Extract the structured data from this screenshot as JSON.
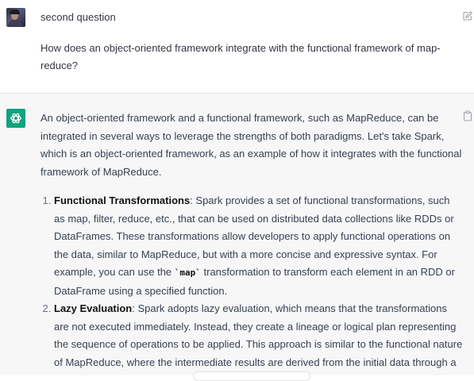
{
  "user_message": {
    "title": "second question",
    "text": "How does an object-oriented framework integrate with the functional framework of map-reduce?"
  },
  "assistant_message": {
    "intro": "An object-oriented framework and a functional framework, such as MapReduce, can be integrated in several ways to leverage the strengths of both paradigms. Let's take Spark, which is an object-oriented framework, as an example of how it integrates with the functional framework of MapReduce.",
    "items": [
      {
        "title": "Functional Transformations",
        "text_before_code": ": Spark provides a set of functional transformations, such as map, filter, reduce, etc., that can be used on distributed data collections like RDDs or DataFrames. These transformations allow developers to apply functional operations on the data, similar to MapReduce, but with a more concise and expressive syntax. For example, you can use the ",
        "code": "`map`",
        "text_after_code": " transformation to transform each element in an RDD or DataFrame using a specified function."
      },
      {
        "title": "Lazy Evaluation",
        "text": ": Spark adopts lazy evaluation, which means that the transformations are not executed immediately. Instead, they create a lineage or logical plan representing the sequence of operations to be applied. This approach is similar to the functional nature of MapReduce, where the intermediate results are derived from the initial data through a"
      }
    ]
  },
  "icons": {
    "user_avatar": "user-avatar",
    "edit": "edit-icon",
    "assistant_avatar": "openai-logo-icon",
    "copy": "clipboard-icon"
  },
  "colors": {
    "assistant_bg": "#f7f7f8",
    "assistant_avatar_bg": "#10a37f",
    "text": "#374151"
  }
}
